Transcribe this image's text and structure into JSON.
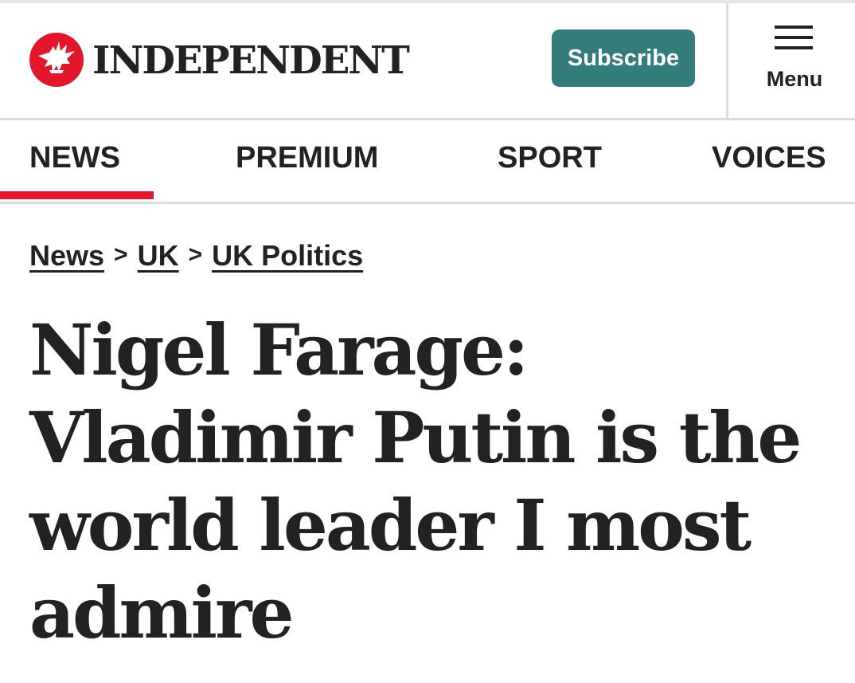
{
  "header": {
    "brand_name": "INDEPENDENT",
    "logo_icon": "eagle-icon",
    "subscribe_label": "Subscribe",
    "menu_label": "Menu",
    "menu_icon": "hamburger-icon"
  },
  "nav": {
    "items": [
      {
        "label": "NEWS",
        "active": true
      },
      {
        "label": "PREMIUM",
        "active": false
      },
      {
        "label": "SPORT",
        "active": false
      },
      {
        "label": "VOICES",
        "active": false
      }
    ]
  },
  "breadcrumb": {
    "items": [
      "News",
      "UK",
      "UK Politics"
    ],
    "separator": ">"
  },
  "article": {
    "headline": "Nigel Farage: Vladimir Putin is the world leader I most admire"
  },
  "colors": {
    "brand_red": "#e3172c",
    "subscribe_teal": "#347b7c",
    "text": "#222222"
  }
}
